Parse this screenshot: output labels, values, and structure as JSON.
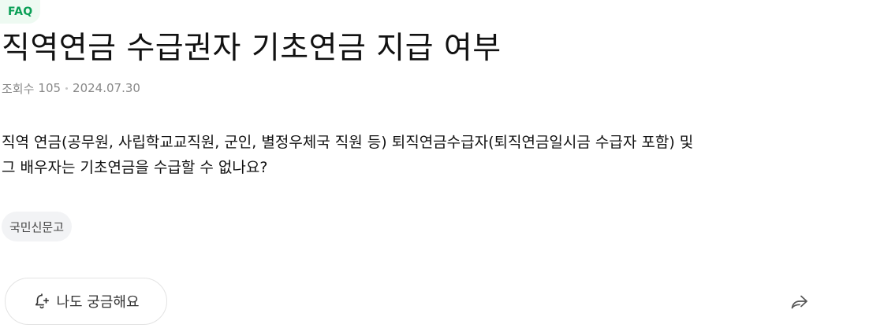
{
  "badge": {
    "label": "FAQ"
  },
  "title": "직역연금 수급권자 기초연금 지급 여부",
  "meta": {
    "views_label": "조회수",
    "views_count": "105",
    "date": "2024.07.30"
  },
  "question": {
    "lines": [
      "직역 연금(공무원, 사립학교교직원, 군인, 별정우체국 직원 등) 퇴직연금수급자(퇴직연금일시금 수급자 포함) 및",
      "그 배우자는 기초연금을 수급할 수 없나요?"
    ]
  },
  "tag": {
    "label": "국민신문고"
  },
  "actions": {
    "curious_label": "나도 궁금해요",
    "curious_icon": "bell-plus-icon",
    "share_icon": "share-icon"
  },
  "colors": {
    "accent": "#0a9f56",
    "badge_bg": "#eefaf2",
    "meta_text": "#888888"
  }
}
